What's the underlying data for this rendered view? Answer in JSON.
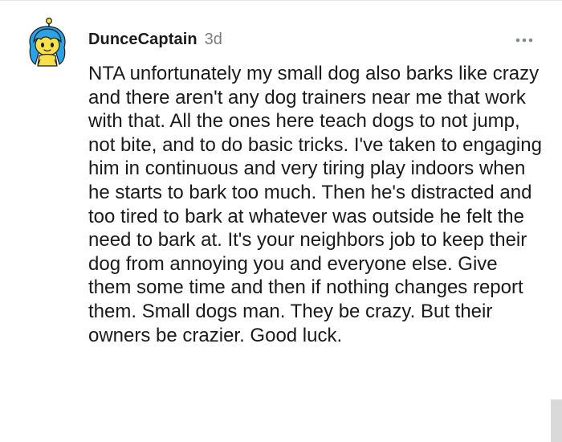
{
  "comment": {
    "author": "DunceCaptain",
    "age": "3d",
    "body": "NTA unfortunately my small dog also barks like crazy and there aren't any dog trainers near me that work with that. All the ones here teach dogs to not jump, not bite, and to do basic tricks. I've taken to engaging him in continuous and very tiring play indoors when he starts to bark too much. Then he's distracted and too tired to bark at whatever was outside he felt the need to bark at. It's your neighbors job to keep their dog from annoying you and everyone else. Give them some time and then if nothing changes report them. Small dogs man. They be crazy. But their owners be crazier. Good luck."
  },
  "icons": {
    "avatar": "snoo-avatar-icon",
    "more": "more-options-icon"
  },
  "colors": {
    "text": "#1a1a1b",
    "muted": "#7c7c7c",
    "avatar_hair": "#2aa2e6",
    "avatar_skin": "#f7e04a"
  }
}
